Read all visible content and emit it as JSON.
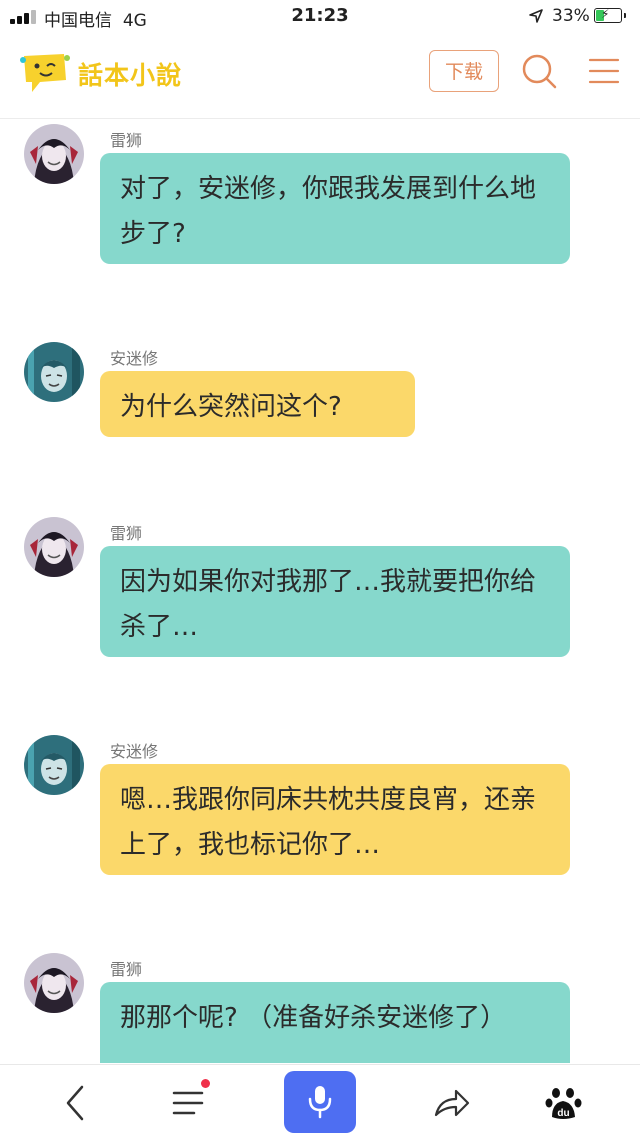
{
  "status_bar": {
    "carrier": "中国电信",
    "network": "4G",
    "time": "21:23",
    "battery": "33%",
    "battery_level": 0.33
  },
  "header": {
    "logo_text": "話本小說",
    "download_label": "下载",
    "icons": [
      "search-icon",
      "menu-icon"
    ],
    "accent_color": "#e28a5b"
  },
  "messages": [
    {
      "speaker": "雷狮",
      "text": "对了，安迷修，你跟我发展到什么地步了?",
      "bubble_color": "#86d8cc"
    },
    {
      "speaker": "安迷修",
      "text": "为什么突然问这个?",
      "bubble_color": "#fbd86a"
    },
    {
      "speaker": "雷狮",
      "text": "因为如果你对我那了…我就要把你给杀了…",
      "bubble_color": "#86d8cc"
    },
    {
      "speaker": "安迷修",
      "text": "嗯…我跟你同床共枕共度良宵，还亲上了，我也标记你了…",
      "bubble_color": "#fbd86a"
    },
    {
      "speaker": "雷狮",
      "text": "那那个呢? （准备好杀安迷修了）",
      "bubble_color": "#86d8cc"
    }
  ],
  "bottom_bar": {
    "icons": [
      "back-icon",
      "list-icon",
      "microphone-icon",
      "share-icon",
      "baidu-paw-icon"
    ],
    "mic_color": "#4e6ef2"
  }
}
